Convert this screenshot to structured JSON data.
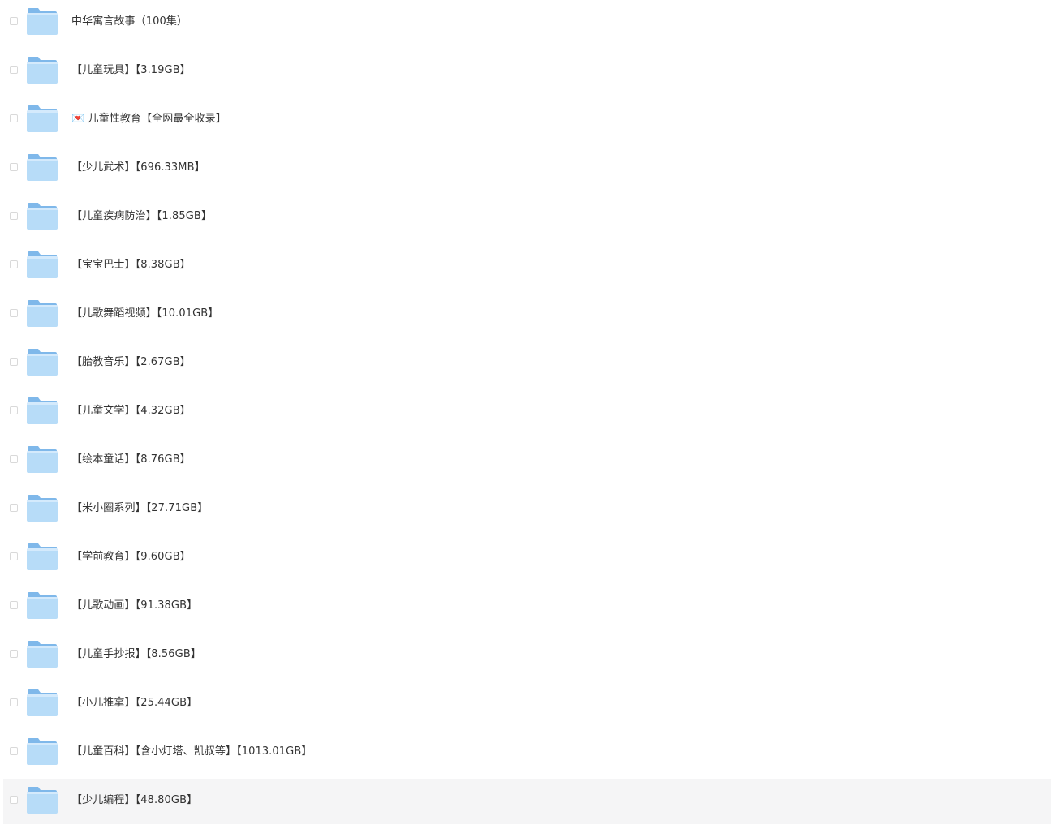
{
  "files": [
    {
      "name": "中华寓言故事（100集）",
      "type": "folder",
      "selected": false
    },
    {
      "name": "【儿童玩具】【3.19GB】",
      "type": "folder",
      "selected": false
    },
    {
      "name": "💌 儿童性教育【全网最全收录】",
      "type": "folder",
      "selected": false
    },
    {
      "name": "【少儿武术】【696.33MB】",
      "type": "folder",
      "selected": false
    },
    {
      "name": "【儿童疾病防治】【1.85GB】",
      "type": "folder",
      "selected": false
    },
    {
      "name": "【宝宝巴士】【8.38GB】",
      "type": "folder",
      "selected": false
    },
    {
      "name": "【儿歌舞蹈视频】【10.01GB】",
      "type": "folder",
      "selected": false
    },
    {
      "name": "【胎教音乐】【2.67GB】",
      "type": "folder",
      "selected": false
    },
    {
      "name": "【儿童文学】【4.32GB】",
      "type": "folder",
      "selected": false
    },
    {
      "name": "【绘本童话】【8.76GB】",
      "type": "folder",
      "selected": false
    },
    {
      "name": "【米小圈系列】【27.71GB】",
      "type": "folder",
      "selected": false
    },
    {
      "name": "【学前教育】【9.60GB】",
      "type": "folder",
      "selected": false
    },
    {
      "name": "【儿歌动画】【91.38GB】",
      "type": "folder",
      "selected": false
    },
    {
      "name": "【儿童手抄报】【8.56GB】",
      "type": "folder",
      "selected": false
    },
    {
      "name": "【小儿推拿】【25.44GB】",
      "type": "folder",
      "selected": false
    },
    {
      "name": "【儿童百科】【含小灯塔、凯叔等】【1013.01GB】",
      "type": "folder",
      "selected": false
    },
    {
      "name": "【少儿编程】【48.80GB】",
      "type": "folder",
      "selected": false,
      "hovered": true
    }
  ],
  "colors": {
    "folder_back": "#7fb8ea",
    "folder_front": "#b7dcf8",
    "folder_front_highlight": "#d4eafc",
    "text": "#333333",
    "hover_row": "#f5f5f6",
    "checkbox_border": "#d9d9d9"
  },
  "icons": {
    "folder": "folder-icon",
    "checkbox": "checkbox-icon"
  }
}
